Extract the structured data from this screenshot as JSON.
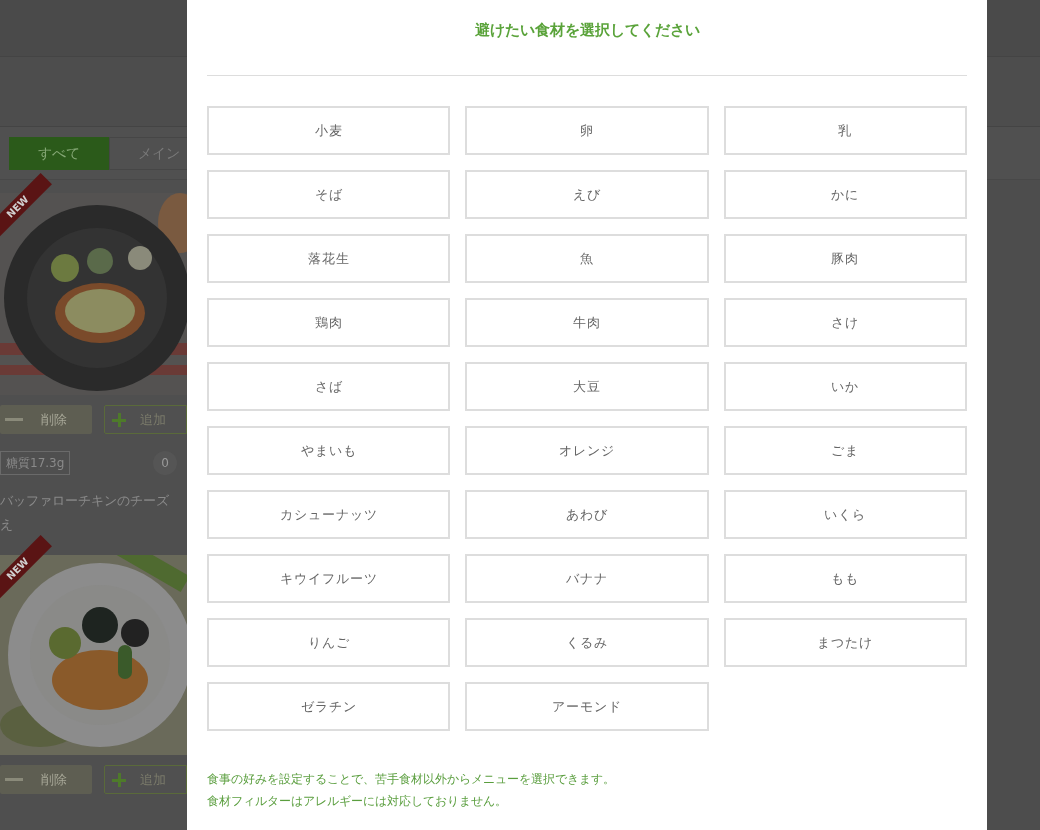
{
  "background": {
    "tabs": [
      {
        "label": "すべて",
        "selected": true
      },
      {
        "label": "メイン",
        "selected": false
      }
    ],
    "cards": [
      {
        "kind": "full",
        "badge": "NEW",
        "remove": "削除",
        "add": "追加",
        "carbs": "糖質17.3g",
        "count": "0",
        "title_lines": [
          "バッファローチキンのチーズ",
          "え"
        ]
      },
      {
        "kind": "partial",
        "badge": "NEW",
        "remove": "削除",
        "add": "追加"
      }
    ]
  },
  "modal": {
    "title": "避けたい食材を選択してください",
    "options": [
      {
        "label": "小麦",
        "selected": false
      },
      {
        "label": "卵",
        "selected": false
      },
      {
        "label": "乳",
        "selected": false
      },
      {
        "label": "そば",
        "selected": false
      },
      {
        "label": "えび",
        "selected": false
      },
      {
        "label": "かに",
        "selected": false
      },
      {
        "label": "落花生",
        "selected": false
      },
      {
        "label": "魚",
        "selected": false
      },
      {
        "label": "豚肉",
        "selected": false
      },
      {
        "label": "鶏肉",
        "selected": false
      },
      {
        "label": "牛肉",
        "selected": false
      },
      {
        "label": "さけ",
        "selected": false
      },
      {
        "label": "さば",
        "selected": false
      },
      {
        "label": "大豆",
        "selected": false
      },
      {
        "label": "いか",
        "selected": false
      },
      {
        "label": "やまいも",
        "selected": false
      },
      {
        "label": "オレンジ",
        "selected": false
      },
      {
        "label": "ごま",
        "selected": false
      },
      {
        "label": "カシューナッツ",
        "selected": false
      },
      {
        "label": "あわび",
        "selected": false
      },
      {
        "label": "いくら",
        "selected": false
      },
      {
        "label": "キウイフルーツ",
        "selected": false
      },
      {
        "label": "バナナ",
        "selected": false
      },
      {
        "label": "もも",
        "selected": false
      },
      {
        "label": "りんご",
        "selected": false
      },
      {
        "label": "くるみ",
        "selected": false
      },
      {
        "label": "まつたけ",
        "selected": false
      },
      {
        "label": "ゼラチン",
        "selected": false
      },
      {
        "label": "アーモンド",
        "selected": false
      }
    ],
    "notes": [
      "食事の好みを設定することで、苦手食材以外からメニューを選択できます。",
      "食材フィルターはアレルギーには対応しておりません。"
    ]
  }
}
